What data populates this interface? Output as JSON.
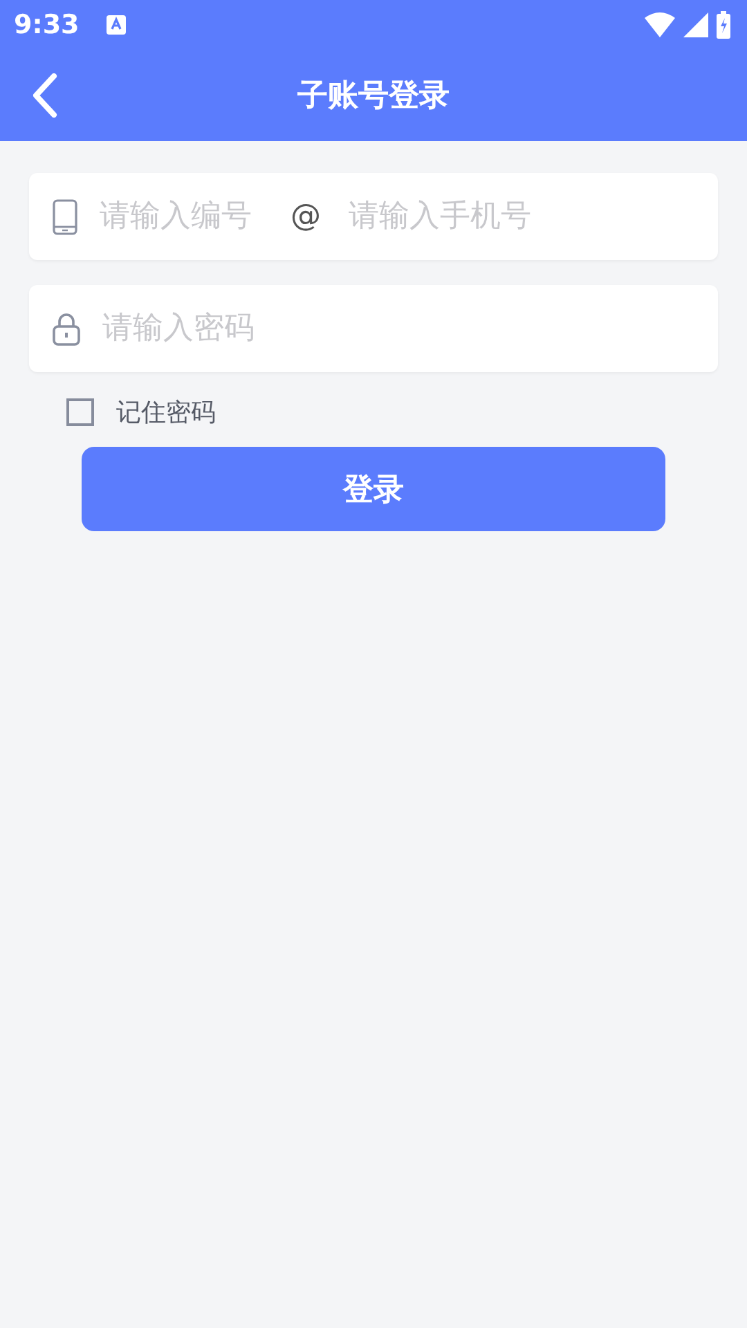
{
  "status_bar": {
    "time": "9:33"
  },
  "header": {
    "title": "子账号登录"
  },
  "account_field": {
    "number_placeholder": "请输入编号",
    "separator": "@",
    "phone_placeholder": "请输入手机号"
  },
  "password_field": {
    "placeholder": "请输入密码"
  },
  "remember": {
    "label": "记住密码",
    "checked": false
  },
  "login_button": {
    "label": "登录"
  }
}
